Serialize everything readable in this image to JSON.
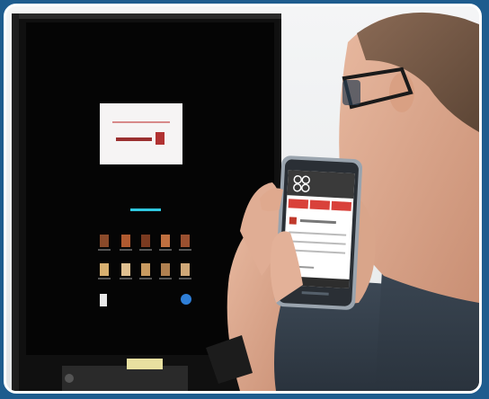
{
  "scene": {
    "frame_color": "#1e5c8e",
    "border_color": "#ffffff",
    "icons": [
      "coffee-cup-icon",
      "phone-app-icon",
      "wristwatch-icon"
    ]
  },
  "machine_screen": {
    "menu_items": [
      {
        "row": 1,
        "col": 1
      },
      {
        "row": 1,
        "col": 2
      },
      {
        "row": 1,
        "col": 3
      },
      {
        "row": 1,
        "col": 4
      },
      {
        "row": 1,
        "col": 5
      },
      {
        "row": 2,
        "col": 1
      },
      {
        "row": 2,
        "col": 2
      },
      {
        "row": 2,
        "col": 3
      },
      {
        "row": 2,
        "col": 4
      },
      {
        "row": 2,
        "col": 5
      }
    ]
  },
  "phone_app": {
    "accent_color": "#d9413a",
    "tabs": [
      "tab-1",
      "tab-2",
      "tab-3"
    ]
  }
}
